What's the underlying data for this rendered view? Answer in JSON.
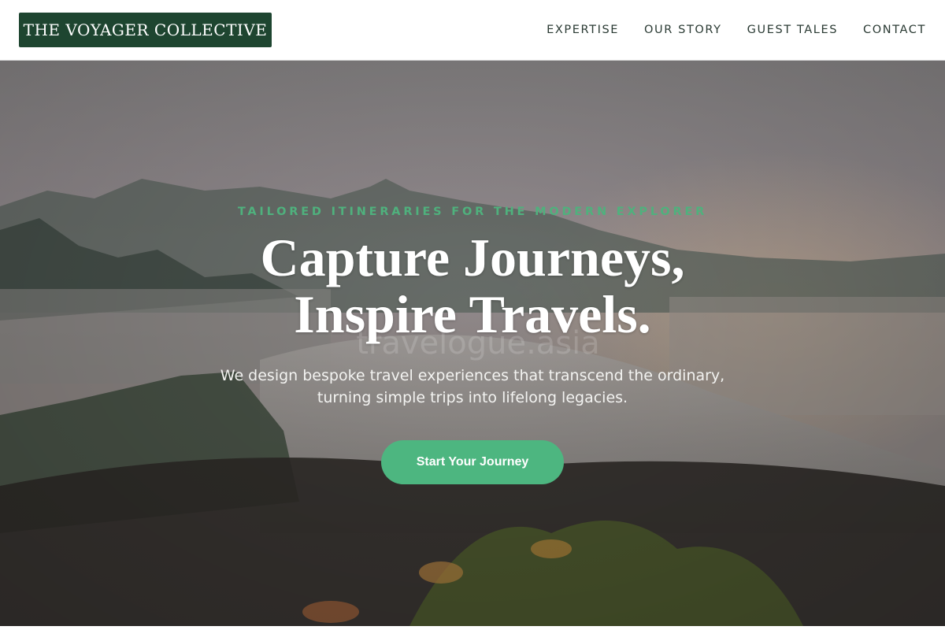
{
  "header": {
    "logo_text": "THE VOYAGER COLLECTIVE",
    "nav": [
      {
        "label": "EXPERTISE"
      },
      {
        "label": "OUR STORY"
      },
      {
        "label": "GUEST TALES"
      },
      {
        "label": "CONTACT"
      }
    ]
  },
  "hero": {
    "eyebrow": "TAILORED ITINERARIES FOR THE MODERN EXPLORER",
    "headline_line1": "Capture Journeys,",
    "headline_line2": "Inspire Travels.",
    "subtitle_line1": "We design bespoke travel experiences that transcend the ordinary,",
    "subtitle_line2": "turning simple trips into lifelong legacies.",
    "cta_label": "Start Your Journey",
    "watermark": "travelogue.asia"
  },
  "colors": {
    "brand_green": "#1e4530",
    "accent_green": "#4db680",
    "nav_text": "#2a3a33"
  }
}
